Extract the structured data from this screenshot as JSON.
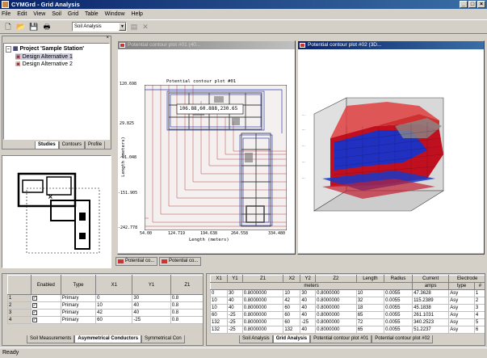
{
  "window": {
    "title": "CYMGrd - Grid Analysis"
  },
  "menu": [
    "File",
    "Edit",
    "View",
    "Soil",
    "Grid",
    "Table",
    "Window",
    "Help"
  ],
  "toolbar": {
    "combo_value": "Soil Analysis"
  },
  "tree": {
    "root": "Project 'Sample Station'",
    "children": [
      "Design Alternative 1",
      "Design Alternative 2"
    ]
  },
  "tree_tabs": [
    "Studies",
    "Contours",
    "Profile"
  ],
  "plot1": {
    "window_title": "Potential contour plot #01 (40...",
    "plot_title": "Potential contour plot #01",
    "tooltip": "106.88,60.888,230.65",
    "xlabel": "Length (meters)",
    "ylabel": "Length (meters)",
    "xticks": [
      "54.00",
      "124.719",
      "194.638",
      "264.558",
      "334.480"
    ],
    "yticks": [
      "120.698",
      "29.825",
      "-61.048",
      "-151.905",
      "-242.778"
    ]
  },
  "plot2": {
    "window_title": "Potential contour plot #02 (3D..."
  },
  "taskbar": [
    "Potential co...",
    "Potential co..."
  ],
  "left_grid": {
    "headers": [
      "",
      "Enabled",
      "Type",
      "X1",
      "Y1",
      "Z1"
    ],
    "rows": [
      [
        "1",
        "✓",
        "Primary",
        "0",
        "30",
        "0.8"
      ],
      [
        "2",
        "✓",
        "Primary",
        "10",
        "40",
        "0.8"
      ],
      [
        "3",
        "✓",
        "Primary",
        "42",
        "40",
        "0.8"
      ],
      [
        "4",
        "✓",
        "Primary",
        "60",
        "-25",
        "0.8"
      ]
    ],
    "tabs": [
      "Soil Measurements",
      "Asymmetrical Conductors",
      "Symmetrical Con"
    ]
  },
  "right_grid": {
    "headers": [
      "X1",
      "Y1",
      "Z1",
      "X2",
      "Y2",
      "Z2",
      "Length",
      "Radius",
      "Current",
      "Electrode"
    ],
    "units": [
      "",
      "",
      "",
      "meters",
      "",
      "",
      "",
      "",
      "amps",
      "type",
      "#"
    ],
    "rows": [
      [
        "0",
        "30",
        "0.8000000",
        "10",
        "30",
        "0.8000000",
        "10",
        "0.0055",
        "47.3628",
        "Asy",
        "1"
      ],
      [
        "10",
        "40",
        "0.8000000",
        "42",
        "40",
        "0.8000000",
        "32",
        "0.0055",
        "115.2389",
        "Asy",
        "2"
      ],
      [
        "10",
        "40",
        "0.8000000",
        "60",
        "40",
        "0.8000000",
        "18",
        "0.0055",
        "45.1838",
        "Asy",
        "3"
      ],
      [
        "60",
        "-25",
        "0.8000000",
        "60",
        "40",
        "0.8000000",
        "65",
        "0.0055",
        "261.1031",
        "Asy",
        "4"
      ],
      [
        "132",
        "-25",
        "0.8000000",
        "60",
        "-25",
        "0.8000000",
        "72",
        "0.0055",
        "340.2523",
        "Asy",
        "5"
      ],
      [
        "132",
        "-25",
        "0.8000000",
        "132",
        "40",
        "0.8000000",
        "65",
        "0.0055",
        "51.2237",
        "Asy",
        "6"
      ]
    ],
    "tabs": [
      "Soil Analysis",
      "Grid Analysis",
      "Potential contour plot #01",
      "Potential contour plot #02"
    ]
  },
  "status": "Ready"
}
